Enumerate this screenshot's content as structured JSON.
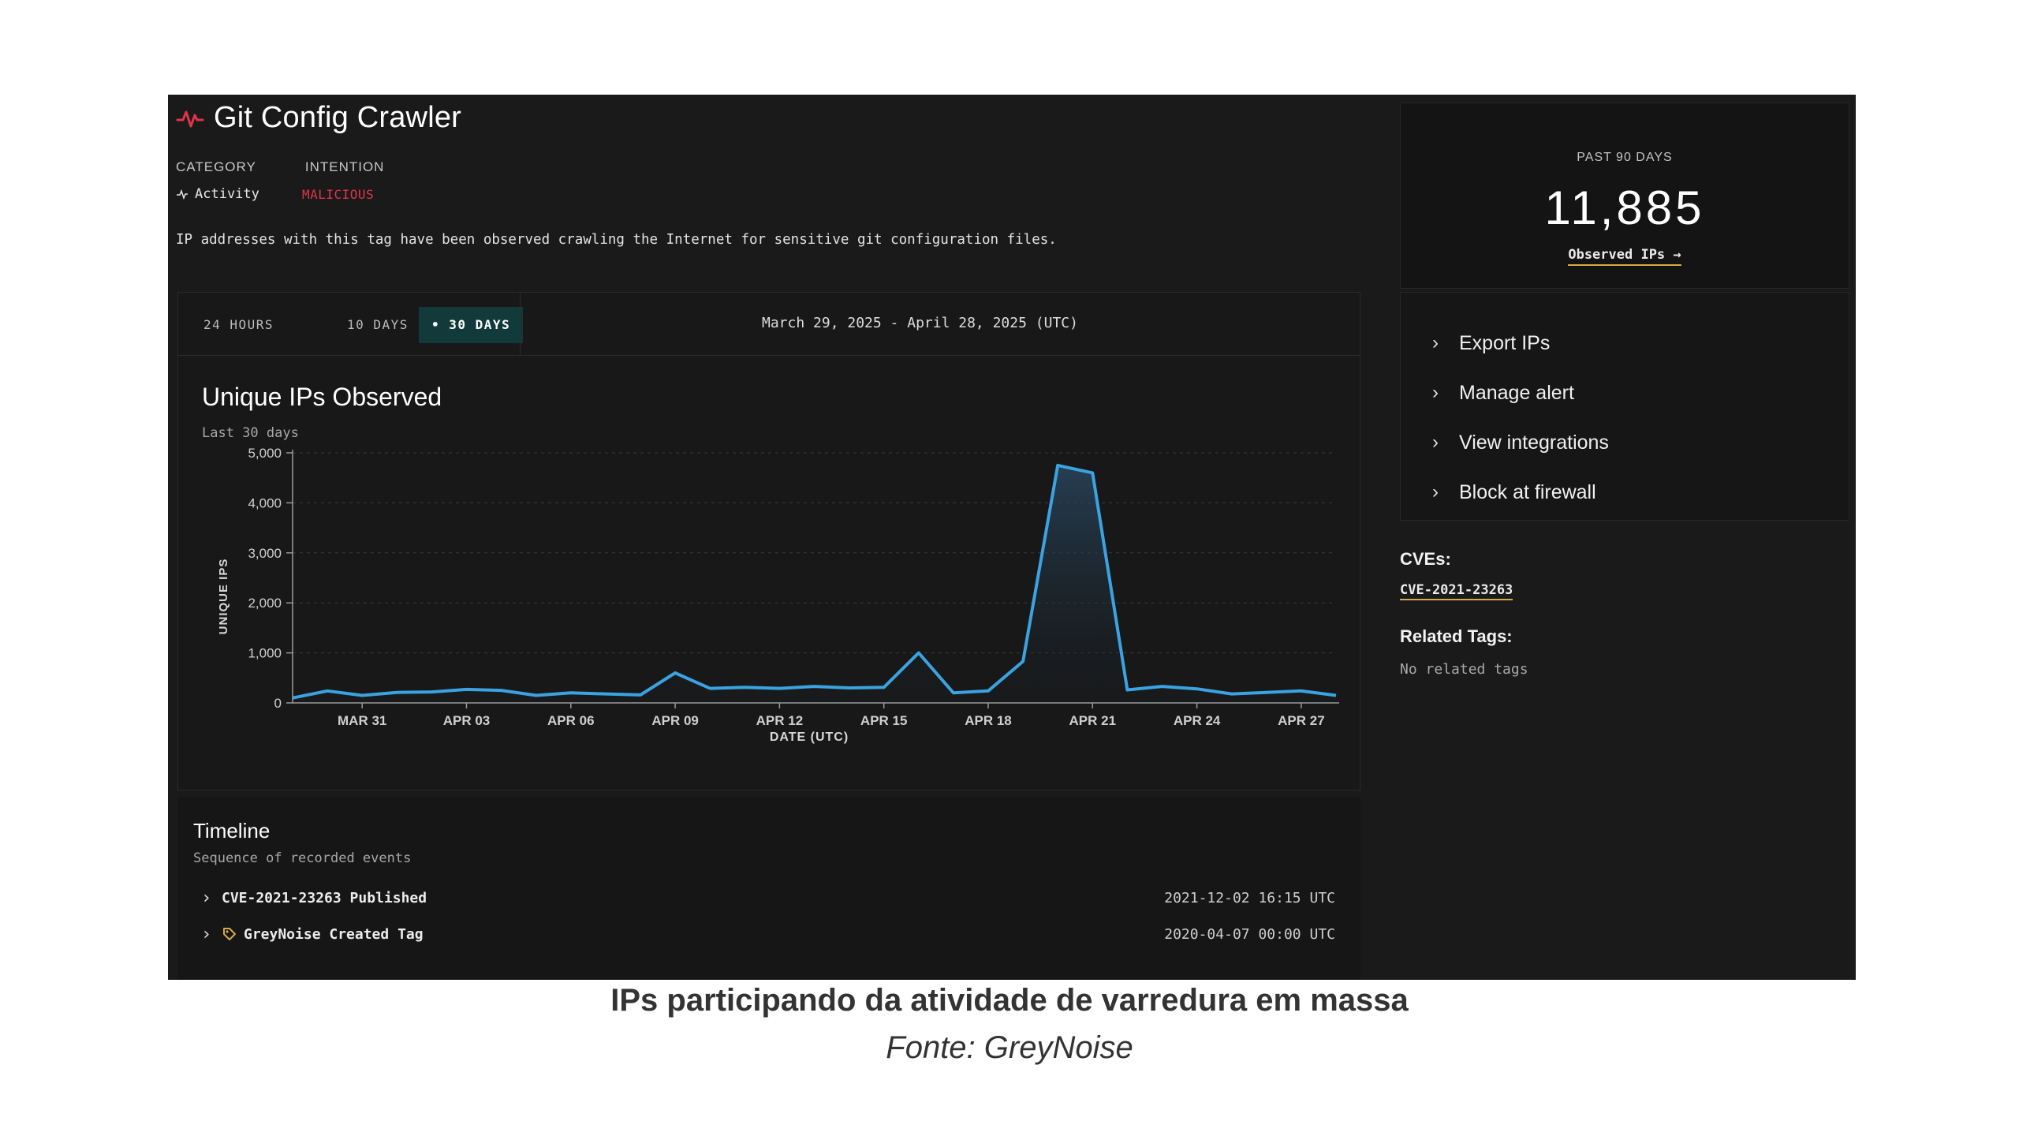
{
  "header": {
    "title": "Git Config Crawler",
    "category_label": "CATEGORY",
    "intention_label": "INTENTION",
    "category_value": "Activity",
    "intention_value": "MALICIOUS",
    "description": "IP addresses with this tag have been observed crawling the Internet for sensitive git configuration files."
  },
  "tabs": [
    {
      "label": "24 HOURS",
      "active": false
    },
    {
      "label": "10 DAYS",
      "active": false
    },
    {
      "label": "• 30 DAYS",
      "active": true
    }
  ],
  "date_range": "March 29, 2025 - April 28, 2025 (UTC)",
  "chart_title": "Unique IPs Observed",
  "chart_subtitle": "Last 30 days",
  "chart_data": {
    "type": "area",
    "title": "Unique IPs Observed",
    "subtitle": "Last 30 days",
    "xlabel": "DATE (UTC)",
    "ylabel": "UNIQUE IPS",
    "ylim": [
      0,
      5000
    ],
    "y_ticks": [
      "0",
      "1,000",
      "2,000",
      "3,000",
      "4,000",
      "5,000"
    ],
    "y_tick_values": [
      0,
      1000,
      2000,
      3000,
      4000,
      5000
    ],
    "x_tick_labels": [
      "MAR 31",
      "APR 03",
      "APR 06",
      "APR 09",
      "APR 12",
      "APR 15",
      "APR 18",
      "APR 21",
      "APR 24",
      "APR 27"
    ],
    "x_tick_indices": [
      2,
      5,
      8,
      11,
      14,
      17,
      20,
      23,
      26,
      29
    ],
    "x": [
      "2025-03-29",
      "2025-03-30",
      "2025-03-31",
      "2025-04-01",
      "2025-04-02",
      "2025-04-03",
      "2025-04-04",
      "2025-04-05",
      "2025-04-06",
      "2025-04-07",
      "2025-04-08",
      "2025-04-09",
      "2025-04-10",
      "2025-04-11",
      "2025-04-12",
      "2025-04-13",
      "2025-04-14",
      "2025-04-15",
      "2025-04-16",
      "2025-04-17",
      "2025-04-18",
      "2025-04-19",
      "2025-04-20",
      "2025-04-21",
      "2025-04-22",
      "2025-04-23",
      "2025-04-24",
      "2025-04-25",
      "2025-04-26",
      "2025-04-27",
      "2025-04-28"
    ],
    "values": [
      100,
      240,
      150,
      210,
      220,
      270,
      250,
      150,
      200,
      180,
      160,
      600,
      290,
      310,
      290,
      330,
      300,
      310,
      1000,
      200,
      240,
      830,
      4750,
      4600,
      260,
      330,
      280,
      180,
      210,
      240,
      150
    ],
    "grid": true,
    "line_color": "#3aa3e0"
  },
  "timeline": {
    "title": "Timeline",
    "subtitle": "Sequence of recorded events",
    "events": [
      {
        "label": "CVE-2021-23263 Published",
        "timestamp": "2021-12-02 16:15 UTC",
        "icon": "none"
      },
      {
        "label": "GreyNoise Created Tag",
        "timestamp": "2020-04-07 00:00 UTC",
        "icon": "tag-icon"
      }
    ]
  },
  "stats": {
    "label": "PAST 90 DAYS",
    "value": "11,885",
    "link": "Observed IPs →"
  },
  "actions": [
    {
      "label": "Export IPs"
    },
    {
      "label": "Manage alert"
    },
    {
      "label": "View integrations"
    },
    {
      "label": "Block at firewall"
    }
  ],
  "cves": {
    "heading": "CVEs:",
    "items": [
      "CVE-2021-23263"
    ]
  },
  "related_tags": {
    "heading": "Related Tags:",
    "empty": "No related tags"
  },
  "caption": "IPs participando da atividade de varredura em massa",
  "source": "Fonte: GreyNoise",
  "colors": {
    "accent_red": "#e0344b",
    "active_tab": "#133a3a",
    "link_underline": "#d6a94a"
  }
}
